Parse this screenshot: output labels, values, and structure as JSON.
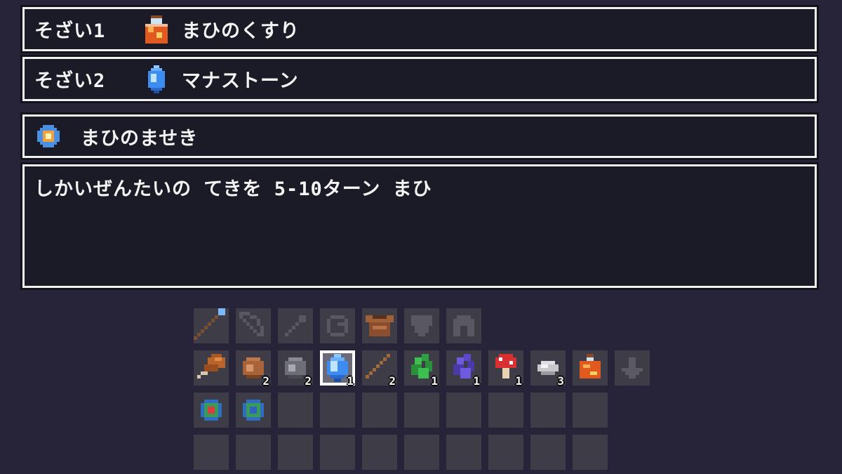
{
  "recipe": {
    "material1": {
      "label": "そざい1",
      "icon": "orange-potion-icon",
      "name": "まひのくすり"
    },
    "material2": {
      "label": "そざい2",
      "icon": "mana-stone-icon",
      "name": "マナストーン"
    }
  },
  "result": {
    "icon": "paralysis-magic-stone-icon",
    "name": "まひのませき",
    "description": "しかいぜんたいの てきを 5-10ターン まひ"
  },
  "inventory": {
    "equipment_row": [
      {
        "icon": "staff-icon",
        "active": true
      },
      {
        "icon": "bow-icon",
        "active": false
      },
      {
        "icon": "arrow-icon",
        "active": false
      },
      {
        "icon": "ring-icon",
        "active": false
      },
      {
        "icon": "leather-armor-icon",
        "active": true
      },
      {
        "icon": "shield-icon",
        "active": false
      },
      {
        "icon": "helmet-icon",
        "active": false
      }
    ],
    "items_row": [
      {
        "icon": "meat-icon",
        "count": ""
      },
      {
        "icon": "copper-ore-icon",
        "count": "2"
      },
      {
        "icon": "iron-ore-icon",
        "count": "2"
      },
      {
        "icon": "mana-stone-icon",
        "count": "1",
        "selected": true
      },
      {
        "icon": "wooden-stick-icon",
        "count": "2"
      },
      {
        "icon": "green-herb-icon",
        "count": "1"
      },
      {
        "icon": "purple-herb-icon",
        "count": "1"
      },
      {
        "icon": "red-mushroom-icon",
        "count": "1"
      },
      {
        "icon": "white-stone-icon",
        "count": "3"
      },
      {
        "icon": "orange-potion-icon",
        "count": ""
      },
      {
        "icon": "down-arrow-icon",
        "count": ""
      }
    ],
    "orbs_row": [
      {
        "icon": "red-orb-icon"
      },
      {
        "icon": "green-orb-icon"
      }
    ]
  },
  "colors": {
    "background": "#27243a",
    "panel": "#1b1a27",
    "border": "#f0f0f0",
    "slot": "#3d3c47"
  }
}
